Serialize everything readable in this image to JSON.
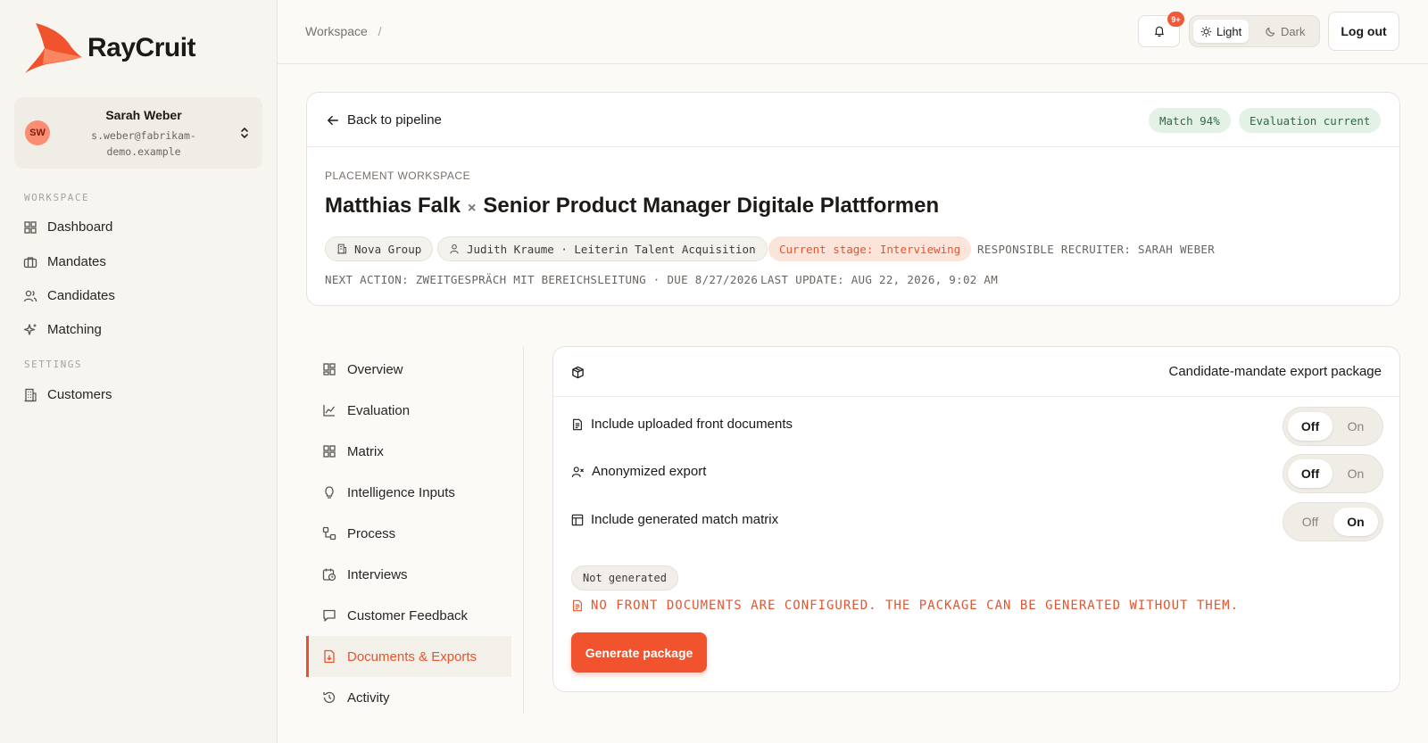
{
  "brand": {
    "name": "RayCruit",
    "accent": "#f0532d"
  },
  "user": {
    "initials": "SW",
    "name": "Sarah Weber",
    "email": "s.weber@fabrikam-demo.example"
  },
  "sidebar": {
    "workspace_label": "WORKSPACE",
    "settings_label": "SETTINGS",
    "workspace_items": [
      {
        "label": "Dashboard",
        "icon": "grid-icon"
      },
      {
        "label": "Mandates",
        "icon": "briefcase-icon"
      },
      {
        "label": "Candidates",
        "icon": "users-icon"
      },
      {
        "label": "Matching",
        "icon": "sparkle-icon"
      }
    ],
    "settings_items": [
      {
        "label": "Customers",
        "icon": "building-icon"
      }
    ]
  },
  "header": {
    "breadcrumb": "Workspace",
    "breadcrumb_sep": "/",
    "notifications_badge": "9+",
    "theme": {
      "light": "Light",
      "dark": "Dark",
      "selected": "Light"
    },
    "logout_label": "Log out"
  },
  "placement": {
    "back_label": "Back to pipeline",
    "match_badge": "Match 94%",
    "evaluation_badge": "Evaluation current",
    "eyebrow": "PLACEMENT WORKSPACE",
    "candidate": "Matthias Falk",
    "times": "×",
    "role": "Senior Product Manager Digitale Plattformen",
    "company": "Nova Group",
    "contact": "Judith Kraume · Leiterin Talent Acquisition",
    "stage": "Current stage: Interviewing",
    "recruiter": "RESPONSIBLE RECRUITER: SARAH WEBER",
    "next_action": "NEXT ACTION: ZWEITGESPRÄCH MIT BEREICHSLEITUNG · DUE 8/27/2026",
    "last_update": "LAST UPDATE: AUG 22, 2026, 9:02 AM"
  },
  "subnav": {
    "items": [
      {
        "label": "Overview",
        "icon": "grid-icon"
      },
      {
        "label": "Evaluation",
        "icon": "line-chart-icon"
      },
      {
        "label": "Matrix",
        "icon": "grid-icon"
      },
      {
        "label": "Intelligence Inputs",
        "icon": "lightbulb-icon"
      },
      {
        "label": "Process",
        "icon": "workflow-icon"
      },
      {
        "label": "Interviews",
        "icon": "calendar-clock-icon"
      },
      {
        "label": "Customer Feedback",
        "icon": "message-icon"
      },
      {
        "label": "Documents & Exports",
        "icon": "file-download-icon"
      },
      {
        "label": "Activity",
        "icon": "history-icon"
      }
    ],
    "active": "Documents & Exports"
  },
  "export": {
    "title": "Candidate-mandate export package",
    "options": [
      {
        "label": "Include uploaded front documents",
        "icon": "file-text-icon",
        "off": "Off",
        "on": "On",
        "value": "Off"
      },
      {
        "label": "Anonymized export",
        "icon": "user-x-icon",
        "off": "Off",
        "on": "On",
        "value": "Off"
      },
      {
        "label": "Include generated match matrix",
        "icon": "table-icon",
        "off": "Off",
        "on": "On",
        "value": "On"
      }
    ],
    "status": "Not generated",
    "warning": "NO FRONT DOCUMENTS ARE CONFIGURED. THE PACKAGE CAN BE GENERATED WITHOUT THEM.",
    "generate_label": "Generate package"
  }
}
